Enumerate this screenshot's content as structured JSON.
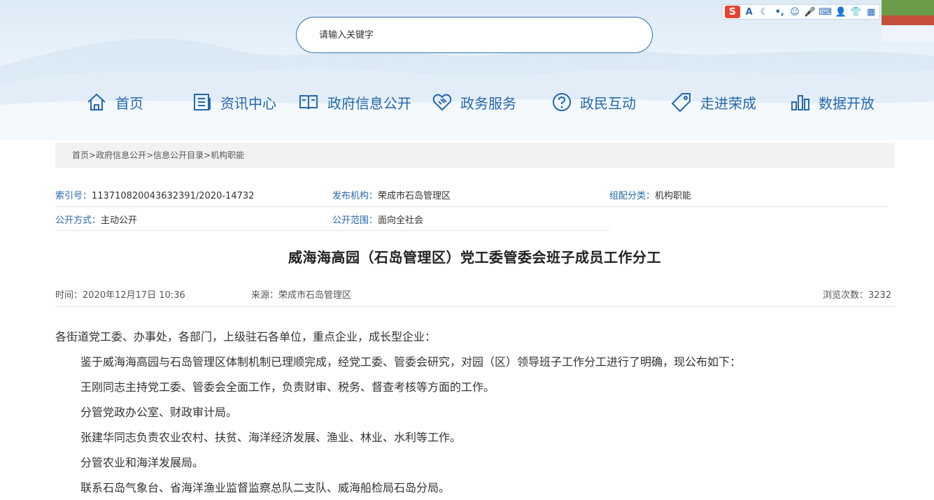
{
  "search": {
    "placeholder": "请输入关键字"
  },
  "ime": {
    "logo": "S",
    "icons": [
      "A",
      "☾",
      "•,",
      "☺",
      "🎤",
      "⌨",
      "👤",
      "👕",
      "▦"
    ]
  },
  "nav": [
    {
      "label": "首页",
      "icon": "home-icon"
    },
    {
      "label": "资讯中心",
      "icon": "news-icon"
    },
    {
      "label": "政府信息公开",
      "icon": "book-icon"
    },
    {
      "label": "政务服务",
      "icon": "handshake-icon"
    },
    {
      "label": "政民互动",
      "icon": "question-icon"
    },
    {
      "label": "走进荣成",
      "icon": "tag-icon"
    },
    {
      "label": "数据开放",
      "icon": "bar-chart-icon"
    }
  ],
  "breadcrumb": {
    "items": [
      "首页",
      "政府信息公开",
      "信息公开目录",
      "机构职能"
    ],
    "sep": ">"
  },
  "meta": {
    "index_key": "索引号：",
    "index_val": "113710820043632391/2020-14732",
    "publisher_key": "发布机构：",
    "publisher_val": "荣成市石岛管理区",
    "category_key": "组配分类：",
    "category_val": "机构职能",
    "method_key": "公开方式：",
    "method_val": "主动公开",
    "scope_key": "公开范围：",
    "scope_val": "面向全社会"
  },
  "article": {
    "title": "威海海高园（石岛管理区）党工委管委会班子成员工作分工",
    "time": "时间：2020年12月17日 10:36",
    "source": "来源：荣成市石岛管理区",
    "views": "浏览次数：3232",
    "paragraphs": [
      "各街道党工委、办事处，各部门，上级驻石各单位，重点企业，成长型企业：",
      "鉴于威海海高园与石岛管理区体制机制已理顺完成，经党工委、管委会研究，对园（区）领导班子工作分工进行了明确，现公布如下：",
      "王刚同志主持党工委、管委会全面工作，负责财审、税务、督查考核等方面的工作。",
      "分管党政办公室、财政审计局。",
      "张建华同志负责农业农村、扶贫、海洋经济发展、渔业、林业、水利等工作。",
      "分管农业和海洋发展局。",
      "联系石岛气象台、省海洋渔业监督监察总队二支队、威海船检局石岛分局。"
    ]
  }
}
